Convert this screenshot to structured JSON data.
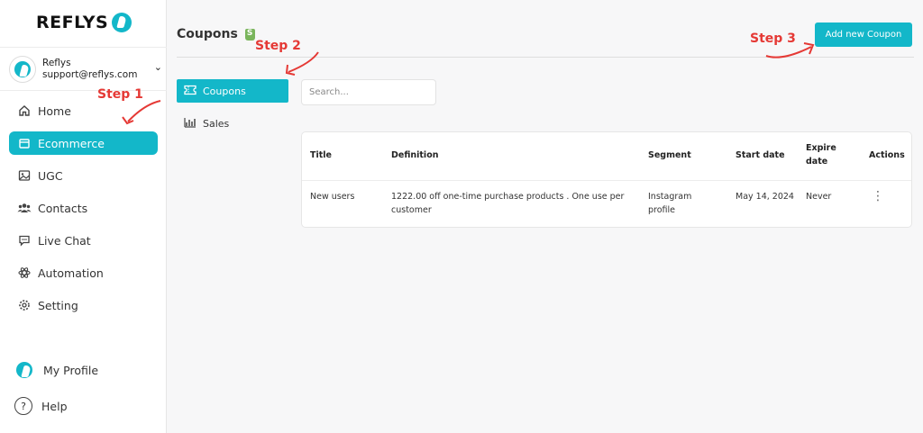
{
  "brand": {
    "name": "REFLYS"
  },
  "account": {
    "name": "Reflys",
    "email": "support@reflys.com"
  },
  "nav": {
    "items": [
      {
        "label": "Home",
        "icon": "home-icon"
      },
      {
        "label": "Ecommerce",
        "icon": "store-icon",
        "active": true
      },
      {
        "label": "UGC",
        "icon": "image-icon"
      },
      {
        "label": "Contacts",
        "icon": "users-icon"
      },
      {
        "label": "Live Chat",
        "icon": "chat-icon"
      },
      {
        "label": "Automation",
        "icon": "atom-icon"
      },
      {
        "label": "Setting",
        "icon": "gear-icon"
      }
    ],
    "bottom": [
      {
        "label": "My Profile",
        "icon": "profile-icon"
      },
      {
        "label": "Help",
        "icon": "help-icon"
      }
    ]
  },
  "header": {
    "title": "Coupons",
    "add_button": "Add new Coupon"
  },
  "subnav": {
    "items": [
      {
        "label": "Coupons",
        "icon": "coupon-icon",
        "active": true
      },
      {
        "label": "Sales",
        "icon": "bar-chart-icon"
      }
    ]
  },
  "search": {
    "placeholder": "Search..."
  },
  "table": {
    "headers": [
      "Title",
      "Definition",
      "Segment",
      "Start date",
      "Expire date",
      "Actions"
    ],
    "rows": [
      {
        "title": "New users",
        "definition": "1222.00 off one-time purchase products . One use per customer",
        "segment": "Instagram profile",
        "start_date": "May 14, 2024",
        "expire_date": "Never"
      }
    ]
  },
  "annotations": {
    "step1": "Step 1",
    "step2": "Step 2",
    "step3": "Step 3"
  },
  "colors": {
    "accent": "#13b7c9",
    "annotation": "#e53935"
  }
}
